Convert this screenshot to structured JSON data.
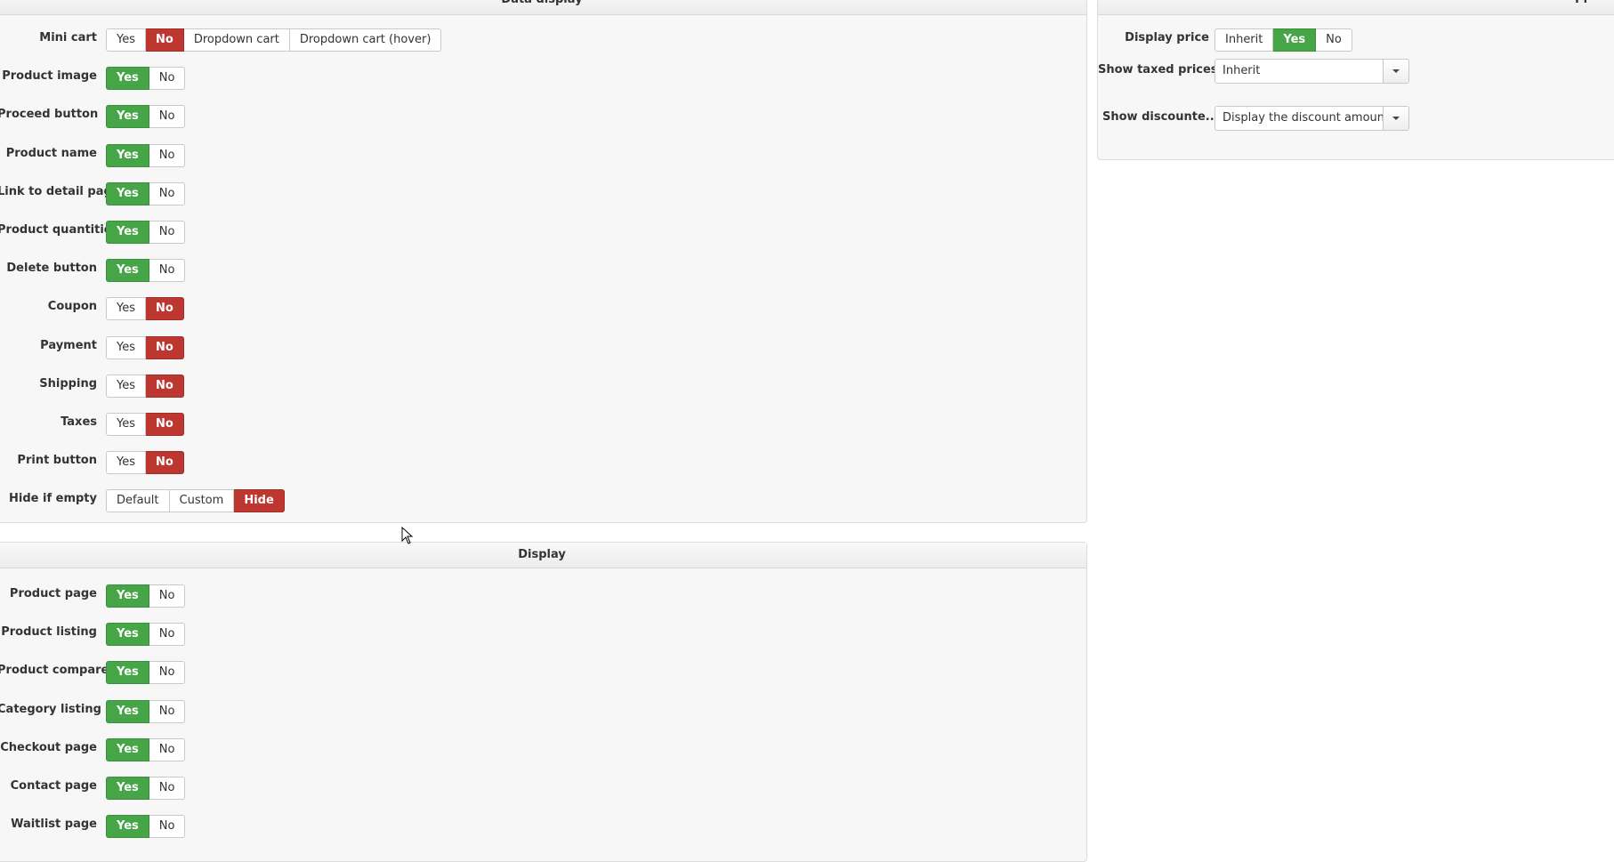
{
  "data_display": {
    "title": "Data display",
    "rows": [
      {
        "label": "Mini cart",
        "options": [
          "Yes",
          "No",
          "Dropdown cart",
          "Dropdown cart (hover)"
        ],
        "selected": 1
      },
      {
        "label": "Product image",
        "options": [
          "Yes",
          "No"
        ],
        "selected": 0
      },
      {
        "label": "Proceed button",
        "options": [
          "Yes",
          "No"
        ],
        "selected": 0
      },
      {
        "label": "Product name",
        "options": [
          "Yes",
          "No"
        ],
        "selected": 0
      },
      {
        "label": "Link to detail page",
        "options": [
          "Yes",
          "No"
        ],
        "selected": 0
      },
      {
        "label": "Product quantities",
        "options": [
          "Yes",
          "No"
        ],
        "selected": 0
      },
      {
        "label": "Delete button",
        "options": [
          "Yes",
          "No"
        ],
        "selected": 0
      },
      {
        "label": "Coupon",
        "options": [
          "Yes",
          "No"
        ],
        "selected": 1
      },
      {
        "label": "Payment",
        "options": [
          "Yes",
          "No"
        ],
        "selected": 1
      },
      {
        "label": "Shipping",
        "options": [
          "Yes",
          "No"
        ],
        "selected": 1
      },
      {
        "label": "Taxes",
        "options": [
          "Yes",
          "No"
        ],
        "selected": 1
      },
      {
        "label": "Print button",
        "options": [
          "Yes",
          "No"
        ],
        "selected": 1
      },
      {
        "label": "Hide if empty",
        "options": [
          "Default",
          "Custom",
          "Hide"
        ],
        "selected": 2
      }
    ]
  },
  "display": {
    "title": "Display",
    "rows": [
      {
        "label": "Product page",
        "options": [
          "Yes",
          "No"
        ],
        "selected": 0
      },
      {
        "label": "Product listing",
        "options": [
          "Yes",
          "No"
        ],
        "selected": 0
      },
      {
        "label": "Product compare",
        "options": [
          "Yes",
          "No"
        ],
        "selected": 0
      },
      {
        "label": "Category listing",
        "options": [
          "Yes",
          "No"
        ],
        "selected": 0
      },
      {
        "label": "Checkout page",
        "options": [
          "Yes",
          "No"
        ],
        "selected": 0
      },
      {
        "label": "Contact page",
        "options": [
          "Yes",
          "No"
        ],
        "selected": 0
      },
      {
        "label": "Waitlist page",
        "options": [
          "Yes",
          "No"
        ],
        "selected": 0
      }
    ]
  },
  "price_panel": {
    "title": "Pr",
    "display_price": {
      "label": "Display price",
      "options": [
        "Inherit",
        "Yes",
        "No"
      ],
      "selected": 1
    },
    "show_taxed_prices": {
      "label": "Show taxed prices",
      "value": "Inherit"
    },
    "show_discounted": {
      "label": "Show discounte...",
      "value": "Display the discount amount"
    }
  },
  "colors": {
    "active_yes": "#46a546",
    "active_no": "#bd362f"
  }
}
